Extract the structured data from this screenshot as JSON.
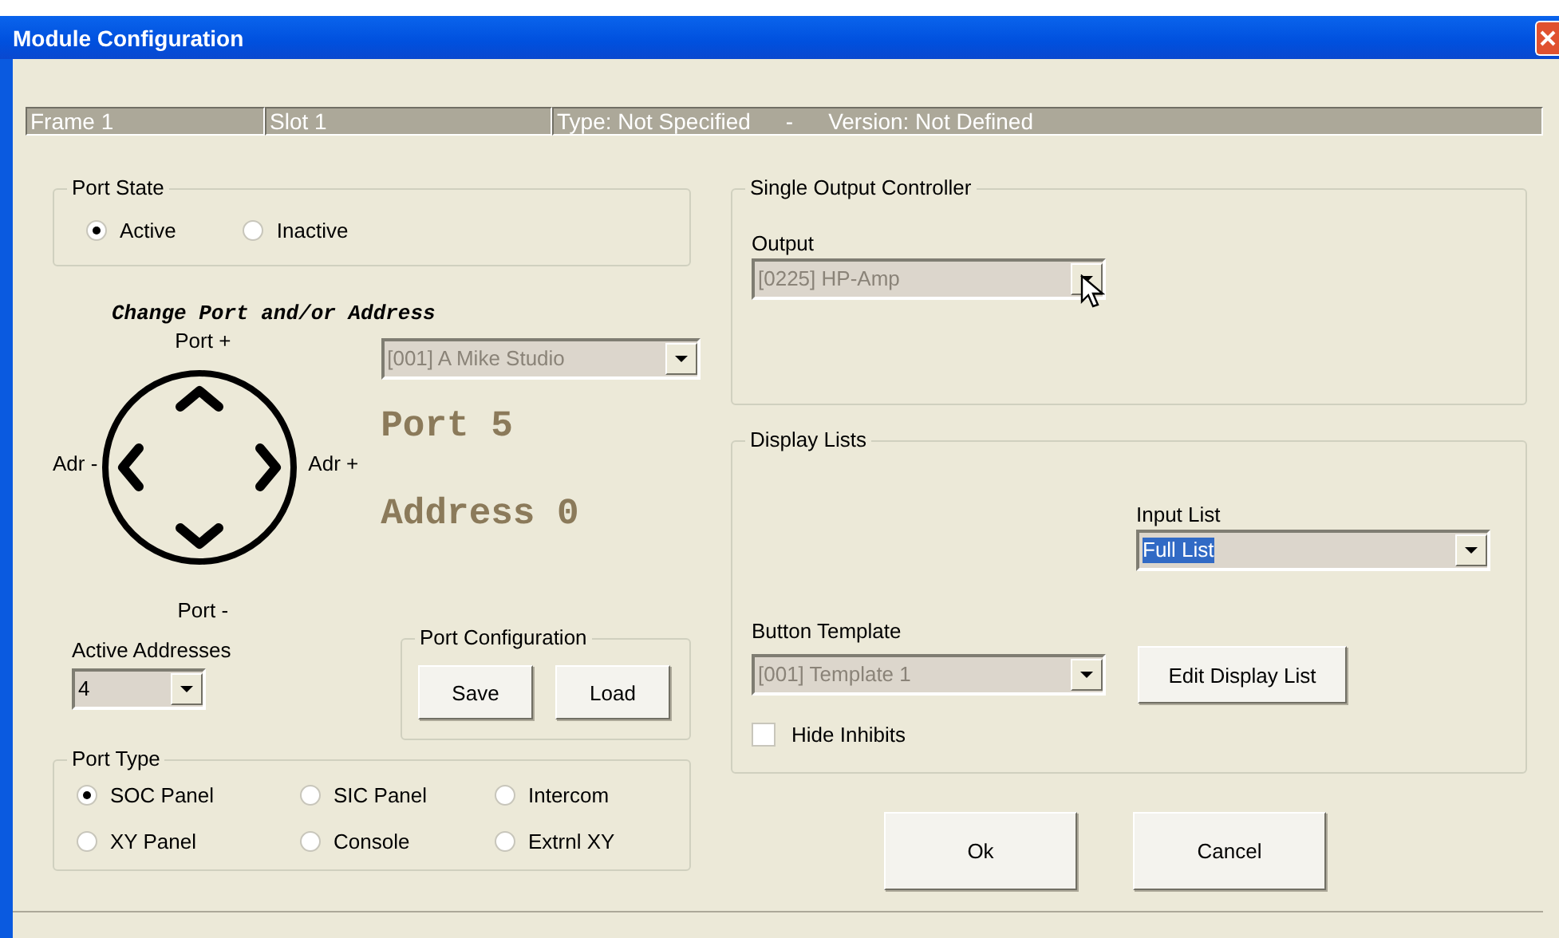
{
  "window": {
    "title": "Module Configuration"
  },
  "status_panels": [
    {
      "texts": [
        "Frame 1"
      ]
    },
    {
      "texts": [
        "Slot 1"
      ]
    },
    {
      "texts": [
        "Type: Not Specified",
        "-",
        "Version: Not Defined"
      ]
    }
  ],
  "port_state": {
    "title": "Port State",
    "options": [
      {
        "label": "Active",
        "selected": true
      },
      {
        "label": "Inactive",
        "selected": false
      }
    ]
  },
  "address_control": {
    "heading": "Change Port and/or Address",
    "port_plus": "Port +",
    "adr_minus": "Adr -",
    "adr_plus": "Adr +",
    "port_minus": "Port -",
    "source": {
      "value": "[001] A Mike Studio",
      "disabled": true,
      "focused": false
    },
    "port": "Port 5",
    "address": "Address 0"
  },
  "active_addresses": {
    "label": "Active Addresses",
    "value": "4",
    "disabled": false,
    "focused": false
  },
  "port_configuration": {
    "title": "Port Configuration",
    "buttons": [
      "Save",
      "Load"
    ]
  },
  "port_type": {
    "title": "Port Type",
    "options": [
      {
        "label": "SOC Panel",
        "selected": true
      },
      {
        "label": "SIC Panel",
        "selected": false
      },
      {
        "label": "Intercom",
        "selected": false
      },
      {
        "label": "XY Panel",
        "selected": false
      },
      {
        "label": "Console",
        "selected": false
      },
      {
        "label": "Extrnl XY",
        "selected": false
      }
    ]
  },
  "single_output_controller": {
    "title": "Single Output Controller",
    "output": {
      "label": "Output",
      "value": "[0225] HP-Amp",
      "disabled": true,
      "focused": false
    }
  },
  "display_lists": {
    "title": "Display Lists",
    "input_list": {
      "label": "Input List",
      "value": "Full List",
      "disabled": false,
      "focused": true
    },
    "button_template": {
      "label": "Button Template",
      "value": "[001] Template 1",
      "disabled": true,
      "focused": false
    },
    "edit_button": "Edit Display List",
    "hide_inhibits": {
      "label": "Hide Inhibits",
      "checked": false
    }
  },
  "buttons": [
    "Ok",
    "Cancel"
  ]
}
